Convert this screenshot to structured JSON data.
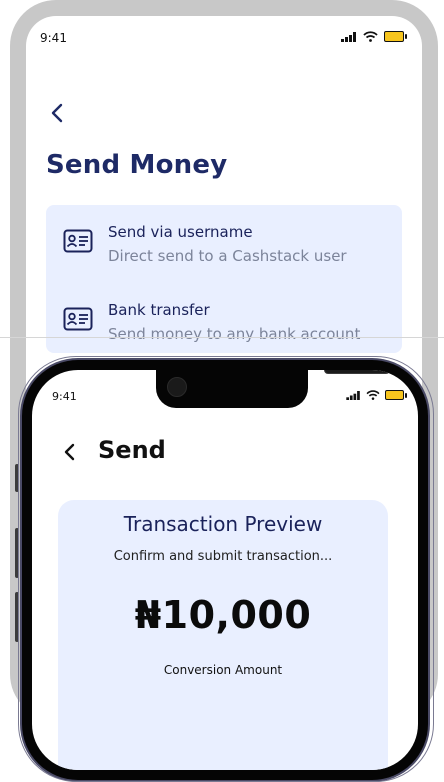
{
  "phone_back": {
    "status_bar": {
      "time": "9:41"
    },
    "back_icon": "chevron-left-icon",
    "title": "Send Money",
    "options": [
      {
        "icon": "id-card-icon",
        "title": "Send via username",
        "subtitle": "Direct send to a Cashstack user"
      },
      {
        "icon": "id-card-icon",
        "title": "Bank transfer",
        "subtitle": "Send money to any bank account"
      }
    ]
  },
  "phone_front": {
    "status_bar": {
      "time": "9:41"
    },
    "back_icon": "chevron-left-icon",
    "title": "Send",
    "preview": {
      "title": "Transaction Preview",
      "subtitle": "Confirm and submit transaction...",
      "amount": "₦10,000",
      "conversion_label": "Conversion Amount"
    }
  },
  "colors": {
    "primary_navy": "#1e2a66",
    "card_background": "#e9efff",
    "battery": "#f7c51e"
  }
}
